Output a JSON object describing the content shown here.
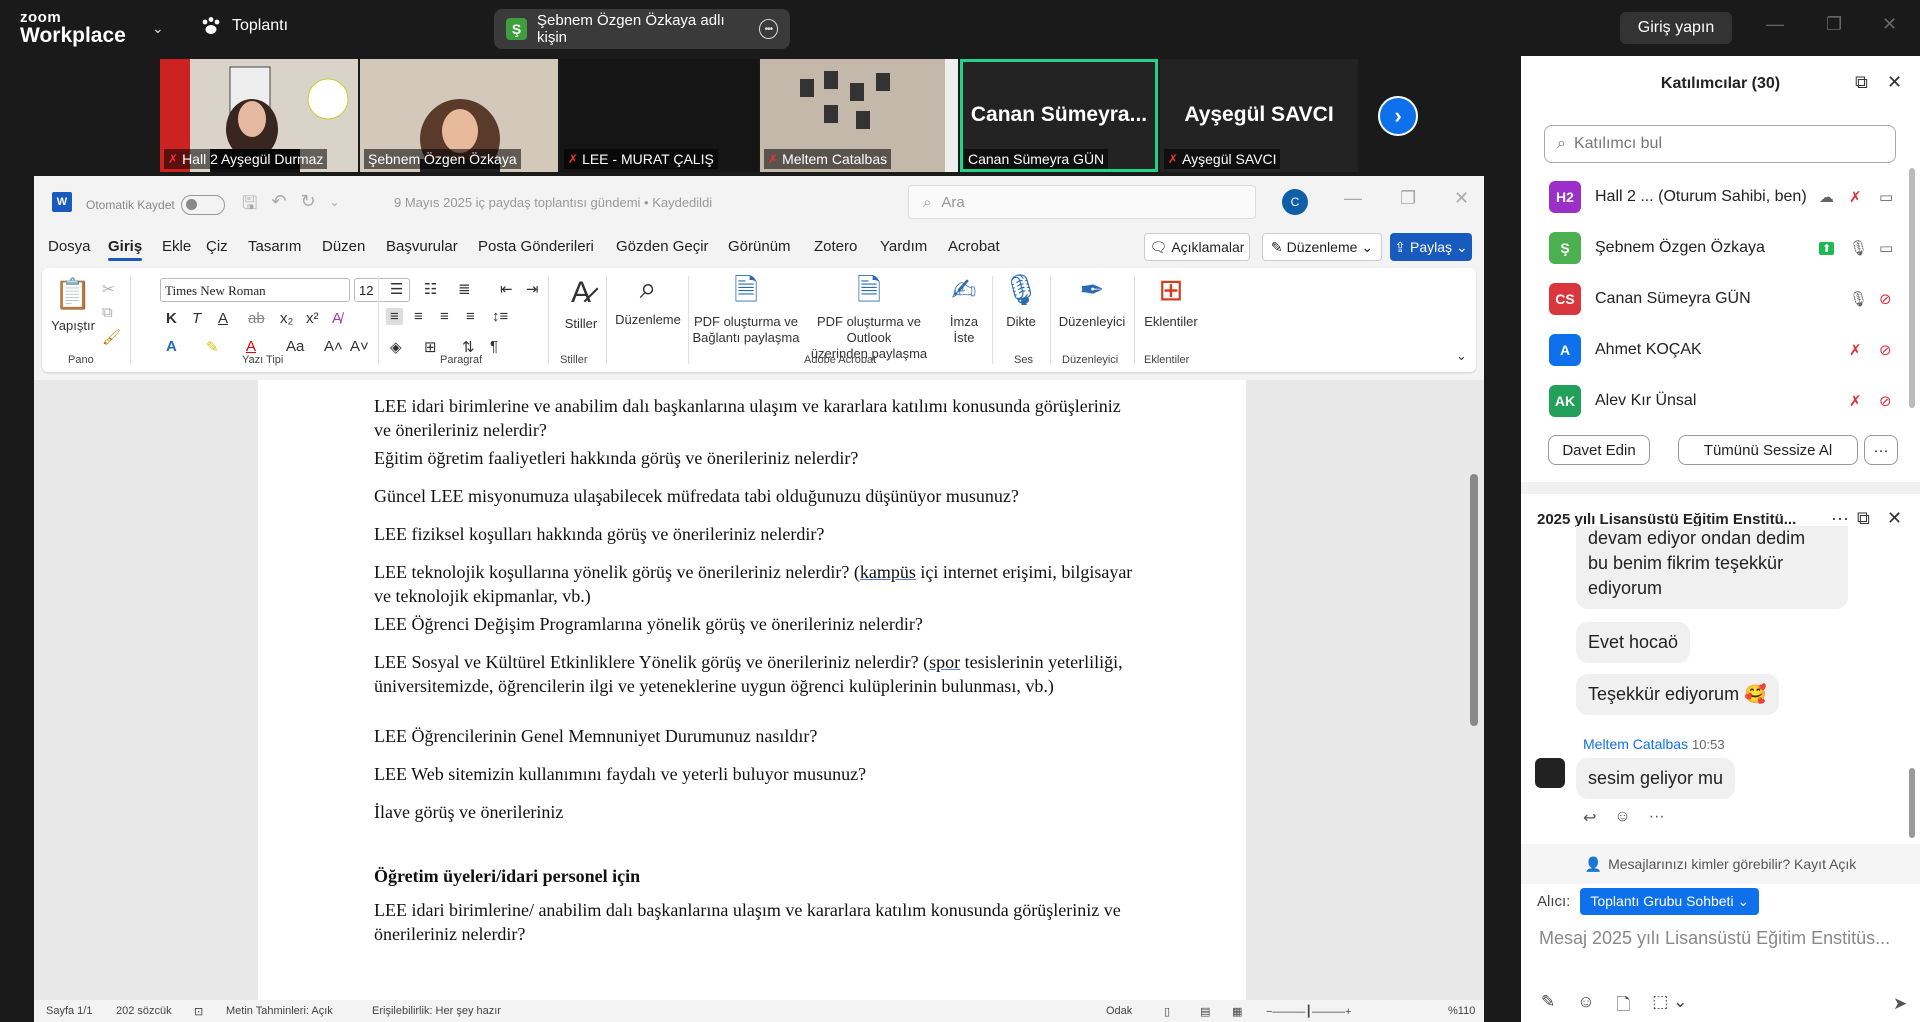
{
  "zoom": {
    "logo_top": "zoom",
    "logo_bottom": "Workplace",
    "meeting_label": "Toplantı",
    "active_speaker": "Şebnem Özgen Özkaya adlı kişin",
    "active_speaker_initial": "Ş",
    "signin_label": "Giriş yapın"
  },
  "video_tiles": [
    {
      "name": "Hall 2 Ayşegül Durmaz",
      "muted": true,
      "bg": "#d9d3c9"
    },
    {
      "name": "Şebnem Özgen Özkaya",
      "muted": false,
      "bg": "#cfc6b8"
    },
    {
      "name": "LEE - MURAT ÇALIŞ",
      "muted": true,
      "bg": "#151515"
    },
    {
      "name": "Meltem Catalbas",
      "muted": true,
      "bg": "#b7aca0"
    },
    {
      "name": "Canan Sümeyra GÜN",
      "muted": false,
      "big": "Canan  Sümeyra...",
      "bg": "#232323"
    },
    {
      "name": "Ayşegül SAVCI",
      "muted": true,
      "big": "Ayşegül SAVCI",
      "bg": "#232323"
    }
  ],
  "word": {
    "autosave_label": "Otomatik Kaydet",
    "doc_title": "9 Mayıs 2025 iç paydaş toplantısı gündemi • Kaydedildi",
    "search_placeholder": "Ara",
    "user_initial": "C",
    "menu": [
      "Dosya",
      "Giriş",
      "Ekle",
      "Çiz",
      "Tasarım",
      "Düzen",
      "Başvurular",
      "Posta Gönderileri",
      "Gözden Geçir",
      "Görünüm",
      "Zotero",
      "Yardım",
      "Acrobat"
    ],
    "active_menu": "Giriş",
    "comments_label": "Açıklamalar",
    "edit_label": "Düzenleme",
    "share_label": "Paylaş",
    "ribbon": {
      "paste_label": "Yapıştır",
      "font_name": "Times New Roman",
      "font_size": "12",
      "styles_label": "Stiller",
      "editing_label": "Düzenleme",
      "pdf_share_label_1": "PDF oluşturma ve",
      "pdf_share_label_2": "Bağlantı paylaşma",
      "pdf_outlook_label_1": "PDF oluşturma ve Outlook",
      "pdf_outlook_label_2": "üzerinden paylaşma",
      "sign_label_1": "İmza",
      "sign_label_2": "İste",
      "dictate_label": "Dikte",
      "editor_label": "Düzenleyici",
      "addins_label": "Eklentiler",
      "groups": {
        "clipboard": "Pano",
        "font": "Yazı Tipi",
        "paragraph": "Paragraf",
        "styles": "Stiller",
        "acrobat": "Adobe Acrobat",
        "voice": "Ses",
        "editor": "Düzenleyici",
        "addins": "Eklentiler"
      }
    },
    "paragraphs": [
      {
        "text": "LEE idari birimlerine ve anabilim dalı başkanlarına ulaşım ve kararlara katılımı konusunda görüşleriniz ve önerileriniz nelerdir?"
      },
      {
        "text": "Eğitim öğretim faaliyetleri hakkında görüş ve önerileriniz nelerdir?"
      },
      {
        "text": "Güncel LEE misyonumuza ulaşabilecek müfredata tabi olduğunuzu düşünüyor musunuz?"
      },
      {
        "text": "LEE fiziksel koşulları hakkında görüş ve önerileriniz nelerdir?"
      },
      {
        "text_a": "LEE teknolojik koşullarına yönelik görüş ve önerileriniz nelerdir? (",
        "text_u": "kampüs",
        "text_b": " içi internet erişimi, bilgisayar ve teknolojik ekipmanlar, vb.)"
      },
      {
        "text": "LEE Öğrenci Değişim Programlarına yönelik görüş ve önerileriniz nelerdir?"
      },
      {
        "text_a": "LEE Sosyal ve Kültürel Etkinliklere Yönelik görüş ve önerileriniz nelerdir? (",
        "text_u": "spor",
        "text_b": " tesislerinin yeterliliği, üniversitemizde, öğrencilerin ilgi ve yeteneklerine uygun öğrenci kulüplerinin bulunması, vb.)"
      },
      {
        "text": "LEE Öğrencilerinin Genel Memnuniyet Durumunuz nasıldır?"
      },
      {
        "text": "LEE Web sitemizin kullanımını faydalı ve yeterli buluyor musunuz?"
      },
      {
        "text": "İlave görüş ve önerileriniz"
      },
      {
        "text": "Öğretim üyeleri/idari personel için",
        "bold": true
      },
      {
        "text": "LEE idari birimlerine/ anabilim dalı başkanlarına ulaşım ve kararlara katılım konusunda görüşleriniz ve önerileriniz nelerdir?"
      }
    ],
    "status": {
      "page": "Sayfa 1/1",
      "words": "202 sözcük",
      "predictions": "Metin Tahminleri: Açık",
      "accessibility": "Erişilebilirlik: Her şey hazır",
      "focus": "Odak",
      "zoom": "%110"
    }
  },
  "participants": {
    "title": "Katılımcılar (30)",
    "search_placeholder": "Katılımcı bul",
    "list": [
      {
        "initials": "H2",
        "name": "Hall 2 ...  (Oturum Sahibi, ben)",
        "color": "#9b30c8"
      },
      {
        "initials": "Ş",
        "name": "Şebnem Özgen Özkaya",
        "color": "#4caf50"
      },
      {
        "initials": "CS",
        "name": "Canan Sümeyra GÜN",
        "color": "#d9363e"
      },
      {
        "initials": "A",
        "name": "Ahmet KOÇAK",
        "color": "#0e71eb"
      },
      {
        "initials": "AK",
        "name": "Alev Kır Ünsal",
        "color": "#22a05a"
      }
    ],
    "invite_label": "Davet Edin",
    "mute_all_label": "Tümünü Sessize Al",
    "more_label": "···"
  },
  "chat": {
    "title": "2025 yılı Lisansüstü Eğitim Enstitü...",
    "messages": [
      {
        "text_1": "devam ediyor  ondan dedim",
        "text_2": "bu benim fikrim teşekkür",
        "text_3": "ediyorum"
      },
      {
        "text": "Evet hocaö"
      },
      {
        "text": "Teşekkür ediyorum",
        "emoji": "🥰"
      },
      {
        "sender": "Meltem Catalbas",
        "time": "10:53",
        "text": "sesim geliyor mu"
      }
    ],
    "who_can_see": "Mesajlarınızı kimler görebilir? Kayıt Açık",
    "to_label": "Alıcı:",
    "to_value": "Toplantı Grubu Sohbeti",
    "input_placeholder": "Mesaj 2025 yılı Lisansüstü Eğitim Enstitüs..."
  }
}
